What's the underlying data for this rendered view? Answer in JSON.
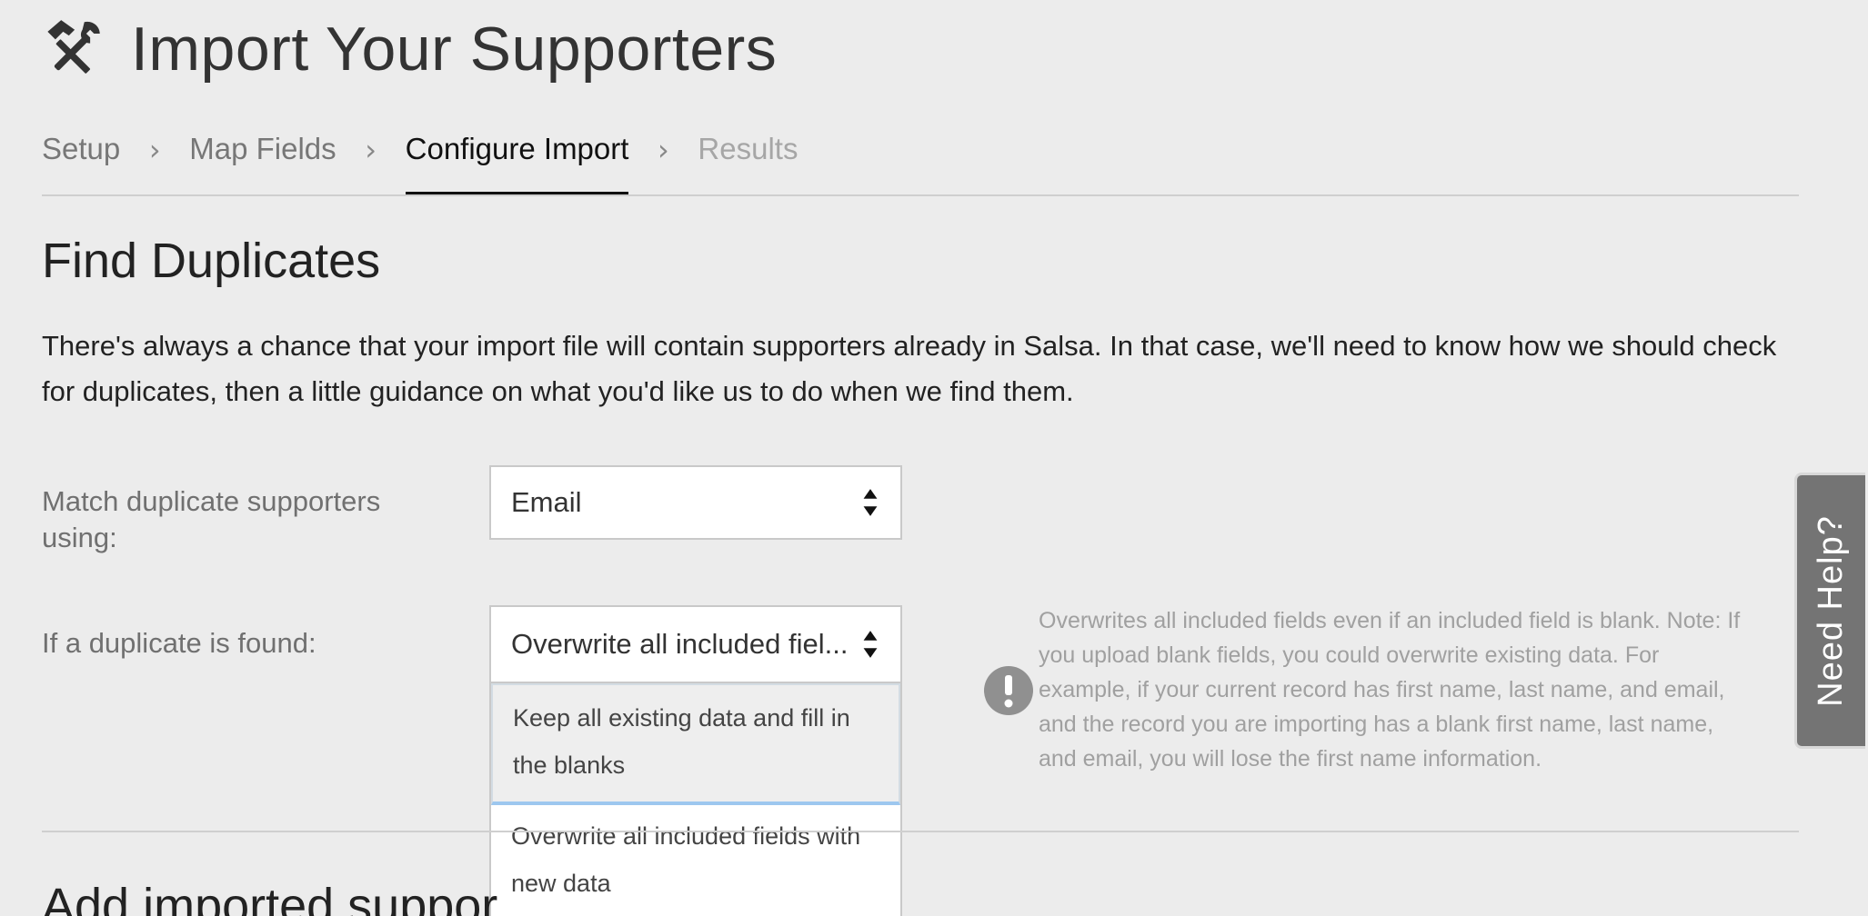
{
  "header": {
    "icon": "tools-icon",
    "title": "Import Your Supporters"
  },
  "stepper": {
    "steps": [
      {
        "label": "Setup",
        "state": "done"
      },
      {
        "label": "Map Fields",
        "state": "done"
      },
      {
        "label": "Configure Import",
        "state": "active"
      },
      {
        "label": "Results",
        "state": "future"
      }
    ],
    "separator": "›"
  },
  "find_duplicates": {
    "title": "Find Duplicates",
    "intro": "There's always a chance that your import file will contain supporters already in Salsa. In that case, we'll need to know how we should check for duplicates, then a little guidance on what you'd like us to do when we find them.",
    "match_label": "Match duplicate supporters using:",
    "match_value": "Email",
    "duplicate_label": "If a duplicate is found:",
    "duplicate_value": "Overwrite all included fiel...",
    "duplicate_options": [
      {
        "label": "Keep all existing data and fill in the blanks",
        "highlighted": true
      },
      {
        "label": "Overwrite all included fields with new data",
        "highlighted": false
      }
    ],
    "info_icon": "exclamation-icon",
    "info_text": "Overwrites all included fields even if an included field is blank. Note: If you upload blank fields, you could overwrite existing data. For example, if your current record has first name, last name, and email, and the record you are importing has a blank first name, last name, and email, you will lose the first name information."
  },
  "next_section": {
    "title": "Add imported suppor"
  },
  "help_tab": {
    "label": "Need Help?"
  },
  "colors": {
    "background": "#ececec",
    "help_tab": "#747474",
    "option_highlight_border": "#9dc7ef"
  }
}
